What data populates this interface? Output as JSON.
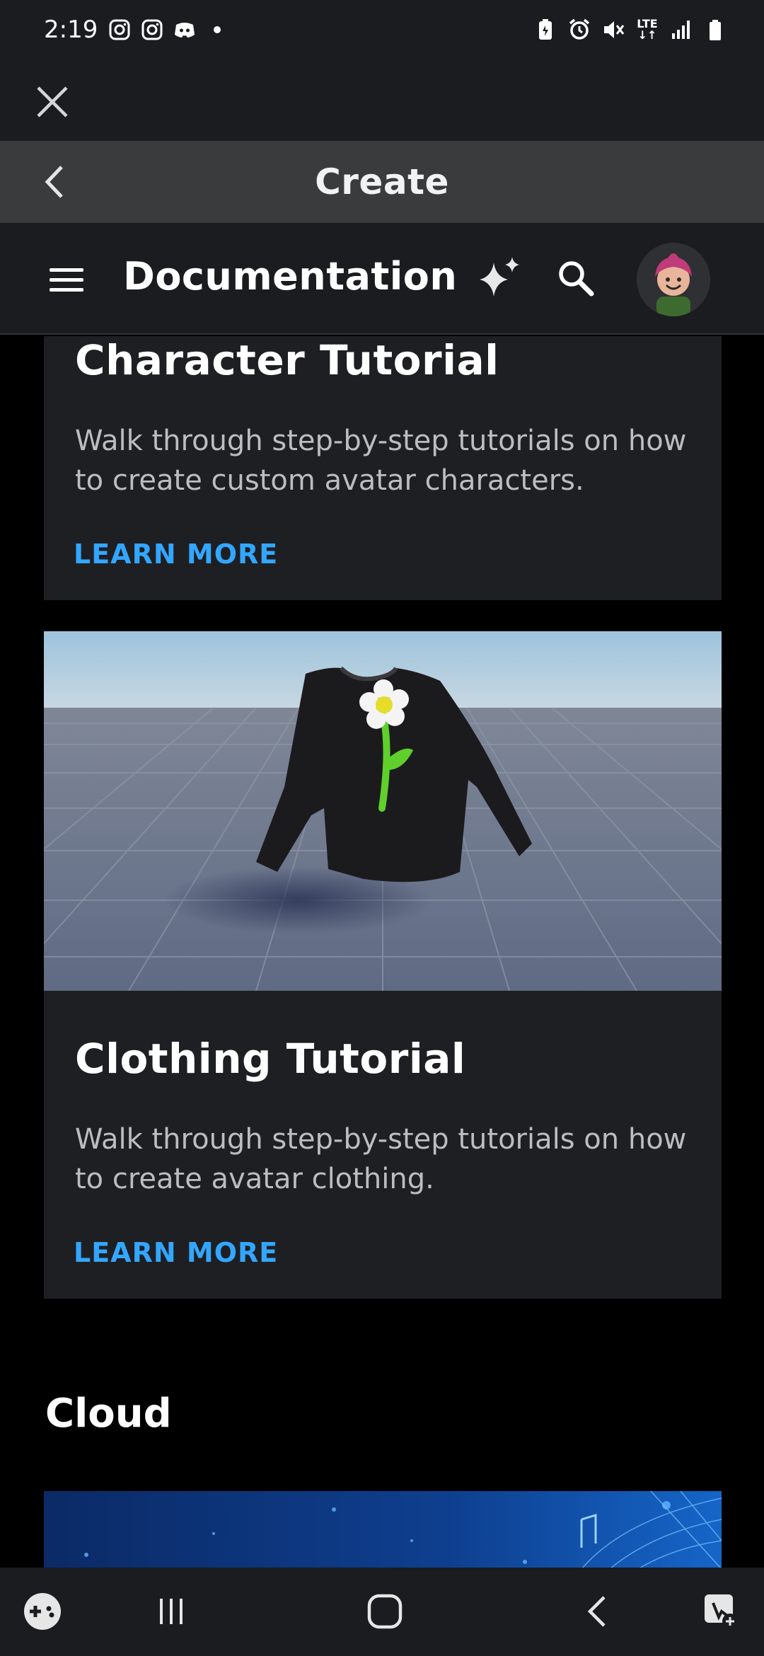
{
  "status_bar": {
    "time": "2:19",
    "left_icons": [
      "instagram-icon",
      "instagram-icon",
      "discord-icon",
      "dot-icon"
    ],
    "right_icons": [
      "battery-saver-icon",
      "alarm-icon",
      "mute-icon",
      "lte-icon",
      "signal-icon",
      "battery-icon"
    ],
    "network": "LTE"
  },
  "browser": {
    "close_icon": "close-icon"
  },
  "create_header": {
    "title": "Create",
    "back_icon": "chevron-left-icon"
  },
  "docs_header": {
    "title": "Documentation",
    "menu_icon": "hamburger-menu-icon",
    "assistant_icon": "sparkle-icon",
    "search_icon": "search-icon",
    "avatar_icon": "avatar-icon"
  },
  "cards": [
    {
      "title": "Character Tutorial",
      "description": "Walk through step-by-step tutorials on how to create custom avatar characters.",
      "cta": "LEARN MORE"
    },
    {
      "title": "Clothing Tutorial",
      "description": "Walk through step-by-step tutorials on how to create avatar clothing.",
      "cta": "LEARN MORE"
    }
  ],
  "sections": {
    "cloud_title": "Cloud"
  },
  "colors": {
    "link": "#33a6ff",
    "card_bg": "#1e1f23",
    "header_bg": "#1b1c1f",
    "create_bar_bg": "#393b3d"
  },
  "nav_bar": {
    "icons": [
      "game-controller-icon",
      "recent-apps-icon",
      "home-icon",
      "back-icon",
      "accessibility-icon"
    ]
  }
}
